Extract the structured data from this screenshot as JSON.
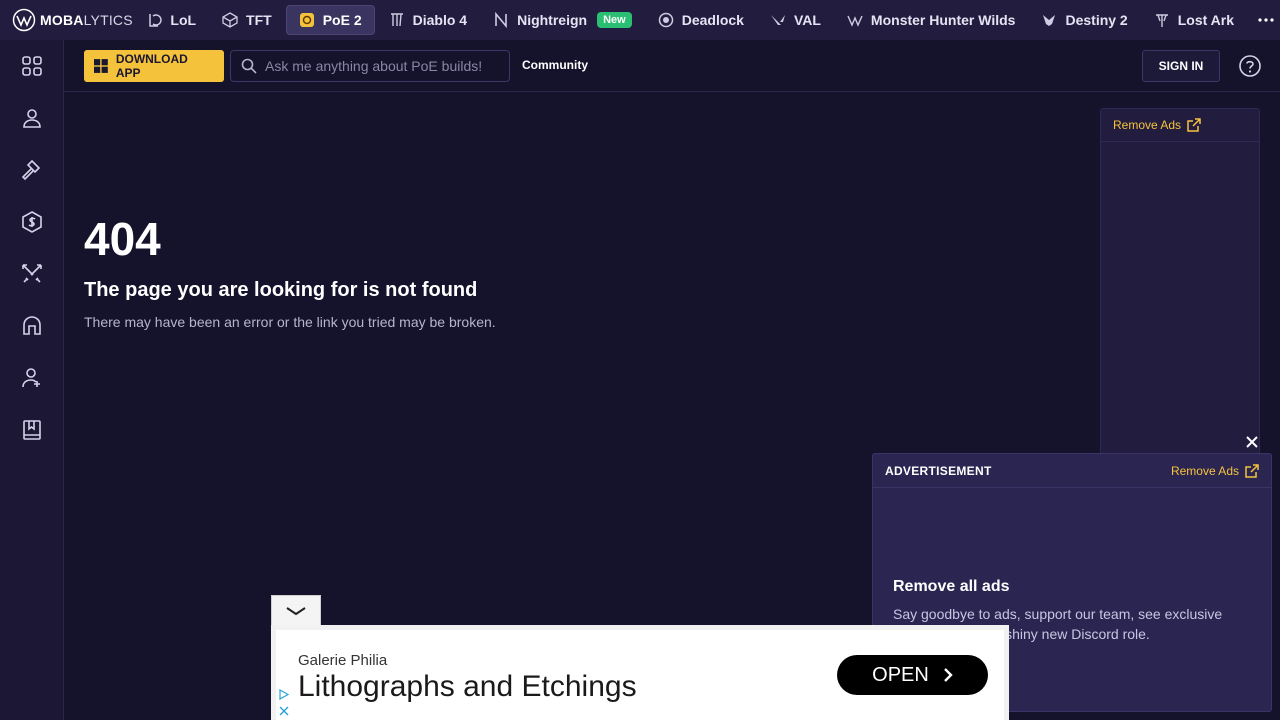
{
  "brand": {
    "logo_bold": "MOBA",
    "logo_thin": "LYTICS"
  },
  "game_tabs": [
    {
      "label": "LoL",
      "icon": "lol-icon"
    },
    {
      "label": "TFT",
      "icon": "tft-icon"
    },
    {
      "label": "PoE 2",
      "icon": "poe2-icon",
      "active": true
    },
    {
      "label": "Diablo 4",
      "icon": "diablo-icon"
    },
    {
      "label": "Nightreign",
      "icon": "nightreign-icon",
      "badge": "New"
    },
    {
      "label": "Deadlock",
      "icon": "deadlock-icon"
    },
    {
      "label": "VAL",
      "icon": "valorant-icon"
    },
    {
      "label": "Monster Hunter Wilds",
      "icon": "monster-hunter-icon"
    },
    {
      "label": "Destiny 2",
      "icon": "destiny-icon"
    },
    {
      "label": "Lost Ark",
      "icon": "lost-ark-icon"
    }
  ],
  "sidebar": {
    "items": [
      {
        "icon": "grid-icon"
      },
      {
        "icon": "profile-icon"
      },
      {
        "icon": "hammer-icon"
      },
      {
        "icon": "currency-icon"
      },
      {
        "icon": "swords-icon"
      },
      {
        "icon": "helmet-icon"
      },
      {
        "icon": "community-icon"
      },
      {
        "icon": "book-icon"
      }
    ]
  },
  "header": {
    "download_label": "DOWNLOAD APP",
    "search_placeholder": "Ask me anything about PoE builds!",
    "community_label": "Community",
    "signin_label": "SIGN IN"
  },
  "main": {
    "code": "404",
    "title": "The page you are looking for is not found",
    "description": "There may have been an error or the link you tried may be broken."
  },
  "side_ad": {
    "remove_label": "Remove Ads"
  },
  "float_ad": {
    "label": "ADVERTISEMENT",
    "remove_label": "Remove Ads",
    "title": "Remove all ads",
    "description": "Say goodbye to ads, support our team, see exclusive content and get a shiny new Discord role."
  },
  "banner": {
    "brand": "Galerie Philia",
    "headline": "Lithographs and Etchings",
    "cta": "OPEN"
  },
  "colors": {
    "background": "#15122b",
    "nav": "#221d3e",
    "accent": "#f5c33b",
    "new_badge": "#2bbf73"
  }
}
